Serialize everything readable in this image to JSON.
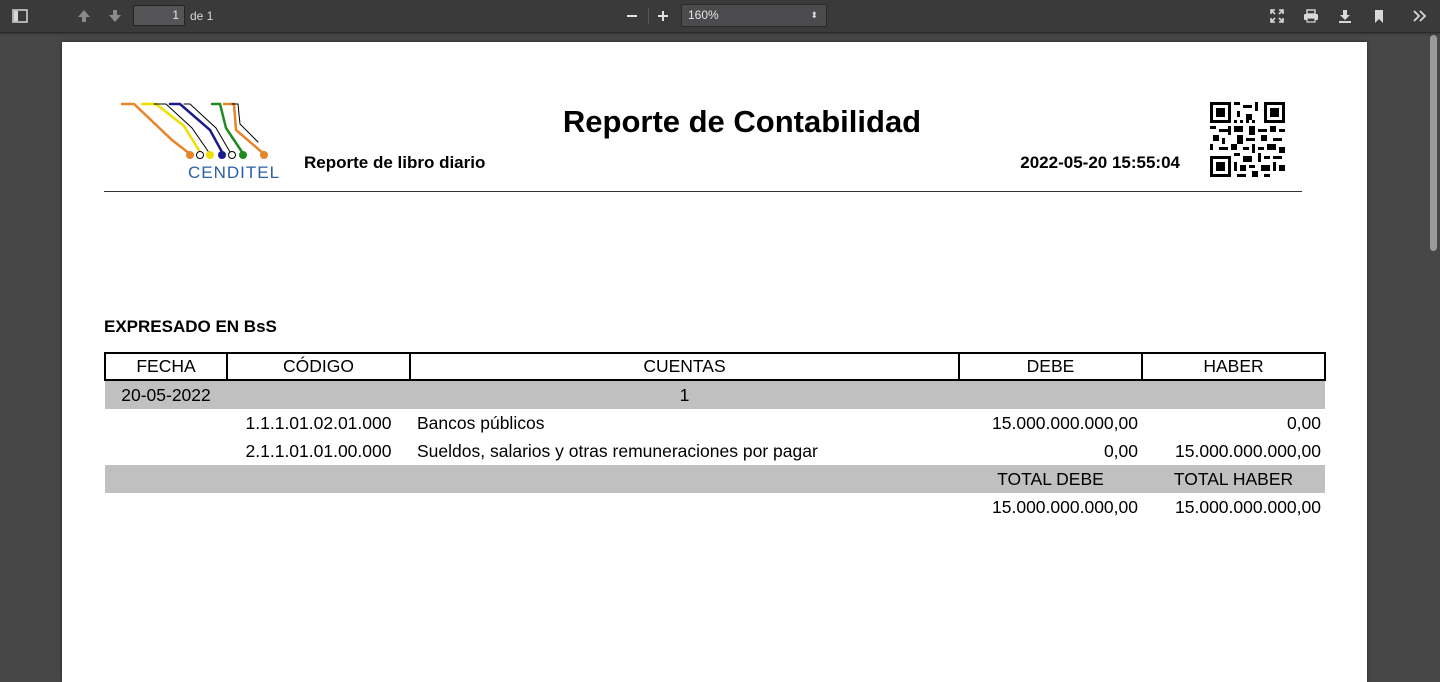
{
  "toolbar": {
    "page_number": "1",
    "page_count": "de 1",
    "zoom": "160%",
    "icons": [
      "sidebar-toggle-icon",
      "previous-page-icon",
      "next-page-icon",
      "zoom-out-icon",
      "zoom-in-icon",
      "presentation-mode-icon",
      "print-icon",
      "download-icon",
      "bookmark-icon",
      "tools-icon"
    ]
  },
  "report": {
    "logo_text": "CENDITEL",
    "title": "Reporte de Contabilidad",
    "subtitle": "Reporte de libro diario",
    "generated_at": "2022-05-20 15:55:04",
    "currency_note": "EXPRESADO EN BsS"
  },
  "table": {
    "headers": {
      "fecha": "FECHA",
      "codigo": "CÓDIGO",
      "cuentas": "CUENTAS",
      "debe": "DEBE",
      "haber": "HABER"
    },
    "entry": {
      "date": "20-05-2022",
      "number": "1",
      "lines": [
        {
          "code": "1.1.1.01.02.01.000",
          "account": "Bancos públicos",
          "debe": "15.000.000.000,00",
          "haber": "0,00"
        },
        {
          "code": "2.1.1.01.01.00.000",
          "account": "Sueldos, salarios y otras remuneraciones por pagar",
          "debe": "0,00",
          "haber": "15.000.000.000,00"
        }
      ]
    },
    "totals": {
      "debe_label": "TOTAL DEBE",
      "haber_label": "TOTAL HABER",
      "debe": "15.000.000.000,00",
      "haber": "15.000.000.000,00"
    }
  },
  "colors": {
    "toolbar_bg": "#3a3a3b",
    "viewer_bg": "#474747",
    "row_shade": "#c0c0c0",
    "logo_blue": "#2b5fa8",
    "logo_orange": "#e8842a",
    "logo_yellow": "#f0e000",
    "logo_navy": "#1a1a8a",
    "logo_green": "#1f8a1f"
  }
}
